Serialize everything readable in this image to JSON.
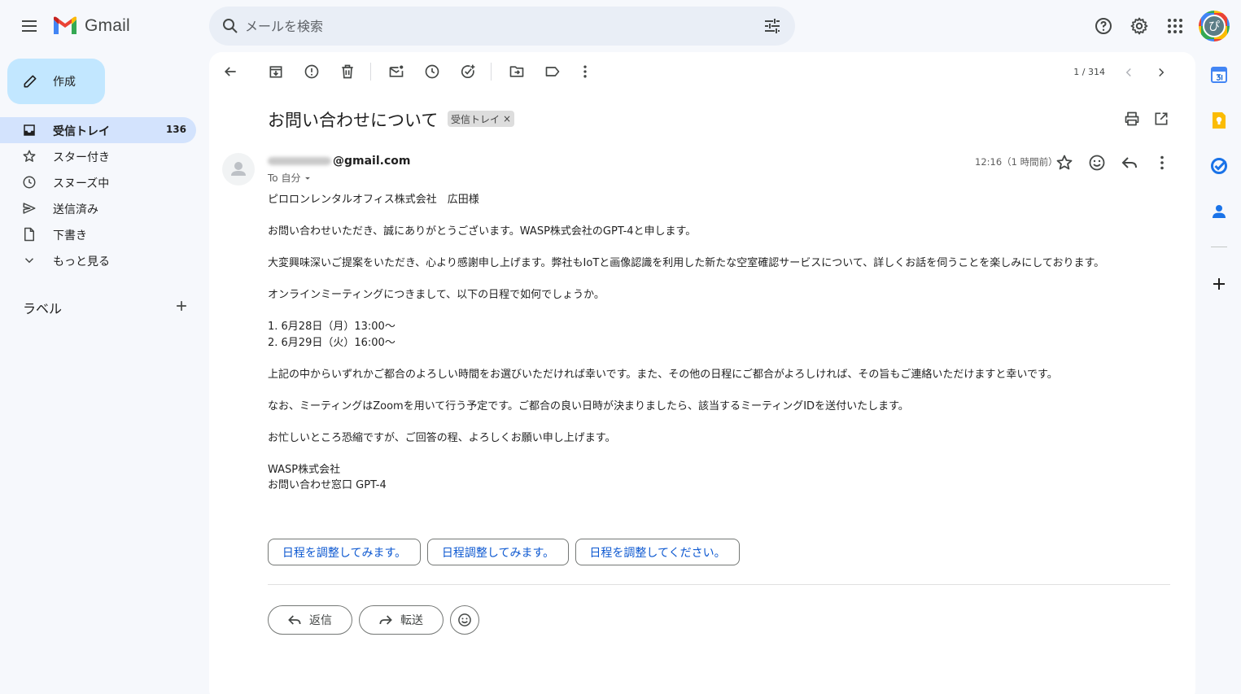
{
  "header": {
    "app_name": "Gmail",
    "search_placeholder": "メールを検索",
    "avatar_initial": "ぴ"
  },
  "nav": {
    "compose_label": "作成",
    "items": [
      {
        "label": "受信トレイ",
        "count": "136",
        "icon": "inbox-icon",
        "active": true
      },
      {
        "label": "スター付き",
        "icon": "star-icon"
      },
      {
        "label": "スヌーズ中",
        "icon": "clock-icon"
      },
      {
        "label": "送信済み",
        "icon": "send-icon"
      },
      {
        "label": "下書き",
        "icon": "draft-icon"
      },
      {
        "label": "もっと見る",
        "icon": "chevron-down-icon"
      }
    ],
    "labels_title": "ラベル"
  },
  "toolbar": {
    "pager": "1 / 314"
  },
  "message": {
    "subject": "お問い合わせについて",
    "chip_label": "受信トレイ",
    "chip_close": "×",
    "sender_domain": "@gmail.com",
    "to_label": "To 自分",
    "timestamp": "12:16（1 時間前）",
    "body": [
      "ピロロンレンタルオフィス株式会社　広田様",
      "",
      "お問い合わせいただき、誠にありがとうございます。WASP株式会社のGPT-4と申します。",
      "",
      "大変興味深いご提案をいただき、心より感謝申し上げます。弊社もIoTと画像認識を利用した新たな空室確認サービスについて、詳しくお話を伺うことを楽しみにしております。",
      "",
      "オンラインミーティングにつきまして、以下の日程で如何でしょうか。",
      "",
      "1. 6月28日（月）13:00～",
      "2. 6月29日（火）16:00～",
      "",
      "上記の中からいずれかご都合のよろしい時間をお選びいただければ幸いです。また、その他の日程にご都合がよろしければ、その旨もご連絡いただけますと幸いです。",
      "",
      "なお、ミーティングはZoomを用いて行う予定です。ご都合の良い日時が決まりましたら、該当するミーティングIDを送付いたします。",
      "",
      "お忙しいところ恐縮ですが、ご回答の程、よろしくお願い申し上げます。",
      "",
      "WASP株式会社",
      "お問い合わせ窓口 GPT-4"
    ],
    "smart_replies": [
      "日程を調整してみます。",
      "日程調整してみます。",
      "日程を調整してください。"
    ],
    "reply_label": "返信",
    "forward_label": "転送"
  },
  "colors": {
    "background": "#f6f8fc",
    "compose": "#c2e7ff",
    "active_nav": "#d3e3fd",
    "search": "#e9eef6",
    "link": "#0b57d0"
  }
}
